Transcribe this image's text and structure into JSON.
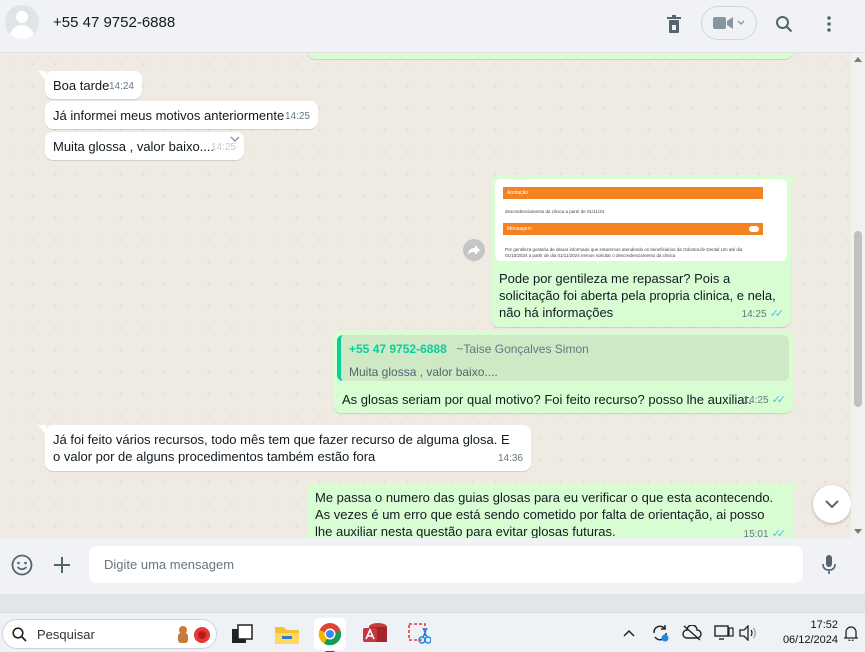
{
  "header": {
    "contact_name": "+55 47 9752-6888"
  },
  "messages": {
    "m1": {
      "text": "Boa tarde",
      "time": "14:24"
    },
    "m2": {
      "text": "Já informei meus motivos anteriormente",
      "time": "14:25"
    },
    "m3": {
      "text": "Muita glossa , valor baixo....",
      "time": "14:25"
    },
    "m4": {
      "image": {
        "bar1": "Anotação",
        "line1": "descredenciamento da clinica a partir de 01/11/24",
        "bar2": "Mensagem",
        "line2": "Por gentileza gostaria de deixar informado que estaremos atendendo os beneficiários da OdontoLife Dental Um até dia",
        "line3": "01/10/2024 a partir de dia 01/11/2024 iremos solicitar o descredenciamento da clinica"
      },
      "text": "Pode por gentileza me repassar? Pois a solicitação foi aberta pela propria clinica, e nela, não há informações",
      "time": "14:25"
    },
    "m5": {
      "quote_name": "+55 47 9752-6888",
      "quote_alias": "~Taise Gonçalves Simon",
      "quote_text": "Muita glossa , valor baixo....",
      "text": "As glosas seriam por qual motivo? Foi feito recurso? posso lhe auxiliar.",
      "time": "14:25"
    },
    "m6": {
      "text": "Já foi feito vários recursos, todo mês tem que fazer recurso de alguma glosa. E o valor por de alguns procedimentos  também estão fora",
      "time": "14:36"
    },
    "m7": {
      "text": "Me passa o numero das guias glosas para eu verificar o que esta acontecendo. As vezes é um erro que está sendo cometido por falta de orientação, ai posso lhe auxiliar nesta questão para evitar glosas futuras.",
      "time": "15:01"
    }
  },
  "composer": {
    "placeholder": "Digite uma mensagem"
  },
  "taskbar": {
    "search_label": "Pesquisar",
    "time": "17:52",
    "date": "06/12/2024"
  },
  "colors": {
    "incoming": "#ffffff",
    "outgoing": "#d9fdd3",
    "accent": "#06cf9c",
    "read_ticks": "#53bdeb"
  }
}
